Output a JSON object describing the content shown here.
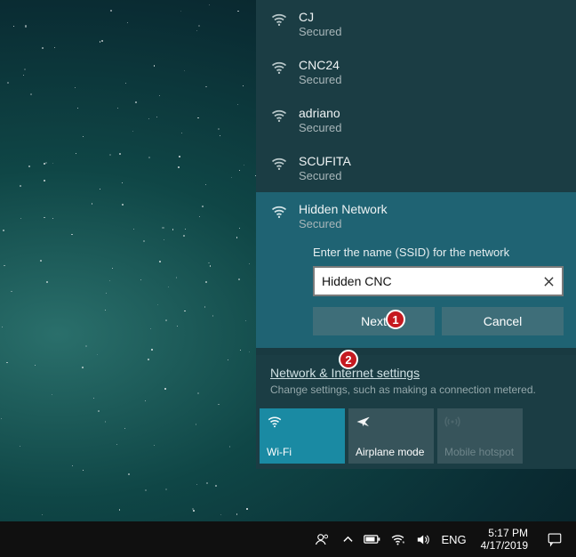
{
  "networks": [
    {
      "name": "CJ",
      "status": "Secured"
    },
    {
      "name": "CNC24",
      "status": "Secured"
    },
    {
      "name": "adriano",
      "status": "Secured"
    },
    {
      "name": "SCUFITA",
      "status": "Secured"
    }
  ],
  "hidden": {
    "name": "Hidden Network",
    "status": "Secured",
    "prompt": "Enter the name (SSID) for the network",
    "input_value": "Hidden CNC",
    "next_label": "Next",
    "cancel_label": "Cancel"
  },
  "settings": {
    "link": "Network & Internet settings",
    "sub": "Change settings, such as making a connection metered."
  },
  "tiles": {
    "wifi": "Wi-Fi",
    "airplane": "Airplane mode",
    "hotspot": "Mobile hotspot"
  },
  "tray": {
    "lang": "ENG",
    "time": "5:17 PM",
    "date": "4/17/2019"
  },
  "annotations": {
    "a1": "1",
    "a2": "2"
  }
}
